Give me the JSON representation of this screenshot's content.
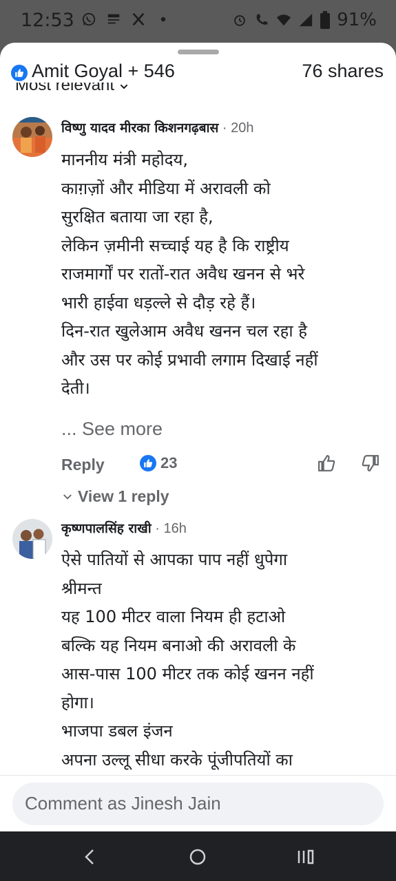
{
  "status_bar": {
    "time": "12:53",
    "battery": "91%",
    "left_icons": [
      "whatsapp-icon",
      "news-app-icon",
      "x-icon",
      "dot-icon"
    ],
    "right_icons": [
      "alarm-icon",
      "wifi-calling-icon",
      "wifi-icon",
      "signal-icon",
      "battery-icon"
    ]
  },
  "header": {
    "reactions": "Amit Goyal + 546",
    "shares": "76 shares",
    "sort_label": "Most relevant"
  },
  "comments": [
    {
      "author": "विष्णु यादव मीरका किशनगढ़बास",
      "time": " · 20h",
      "body": "माननीय मंत्री महोदय,\nकाग़ज़ों और मीडिया में अरावली को\nसुरक्षित बताया जा रहा है,\nलेकिन ज़मीनी सच्चाई यह है कि राष्ट्रीय\nराजमार्गों पर रातों-रात अवैध खनन से भरे\nभारी हाईवा धड़ल्ले से दौड़ रहे हैं।\nदिन-रात खुलेआम अवैध खनन चल रहा है\nऔर उस पर कोई प्रभावी लगाम दिखाई नहीं\nदेती।",
      "see_more": "... See more",
      "reply_label": "Reply",
      "like_count": "23",
      "view_replies": "View 1 reply"
    },
    {
      "author": "कृष्णपालसिंह राखी",
      "time": " · 16h",
      "body": "ऐसे पातियों से आपका पाप नहीं धुपेगा\nश्रीमन्त\nयह 100 मीटर वाला नियम ही हटाओ\nबल्कि यह नियम बनाओ की अरावली के\nआस-पास 100 मीटर तक कोई खनन नहीं\nहोगा।\n                    भाजपा डबल इंजन\nअपना उल्लू सीधा करके पूंजीपतियों का"
    }
  ],
  "composer": {
    "placeholder": "Comment as Jinesh Jain"
  },
  "colors": {
    "facebook_blue": "#1877f2",
    "secondary_text": "#65676b",
    "primary_text": "#1c1e21",
    "status_bar_bg": "#5a5a5a",
    "nav_bar_bg": "#202124"
  },
  "nav_bar": {
    "icons": [
      "back-icon",
      "home-icon",
      "recents-icon"
    ]
  }
}
